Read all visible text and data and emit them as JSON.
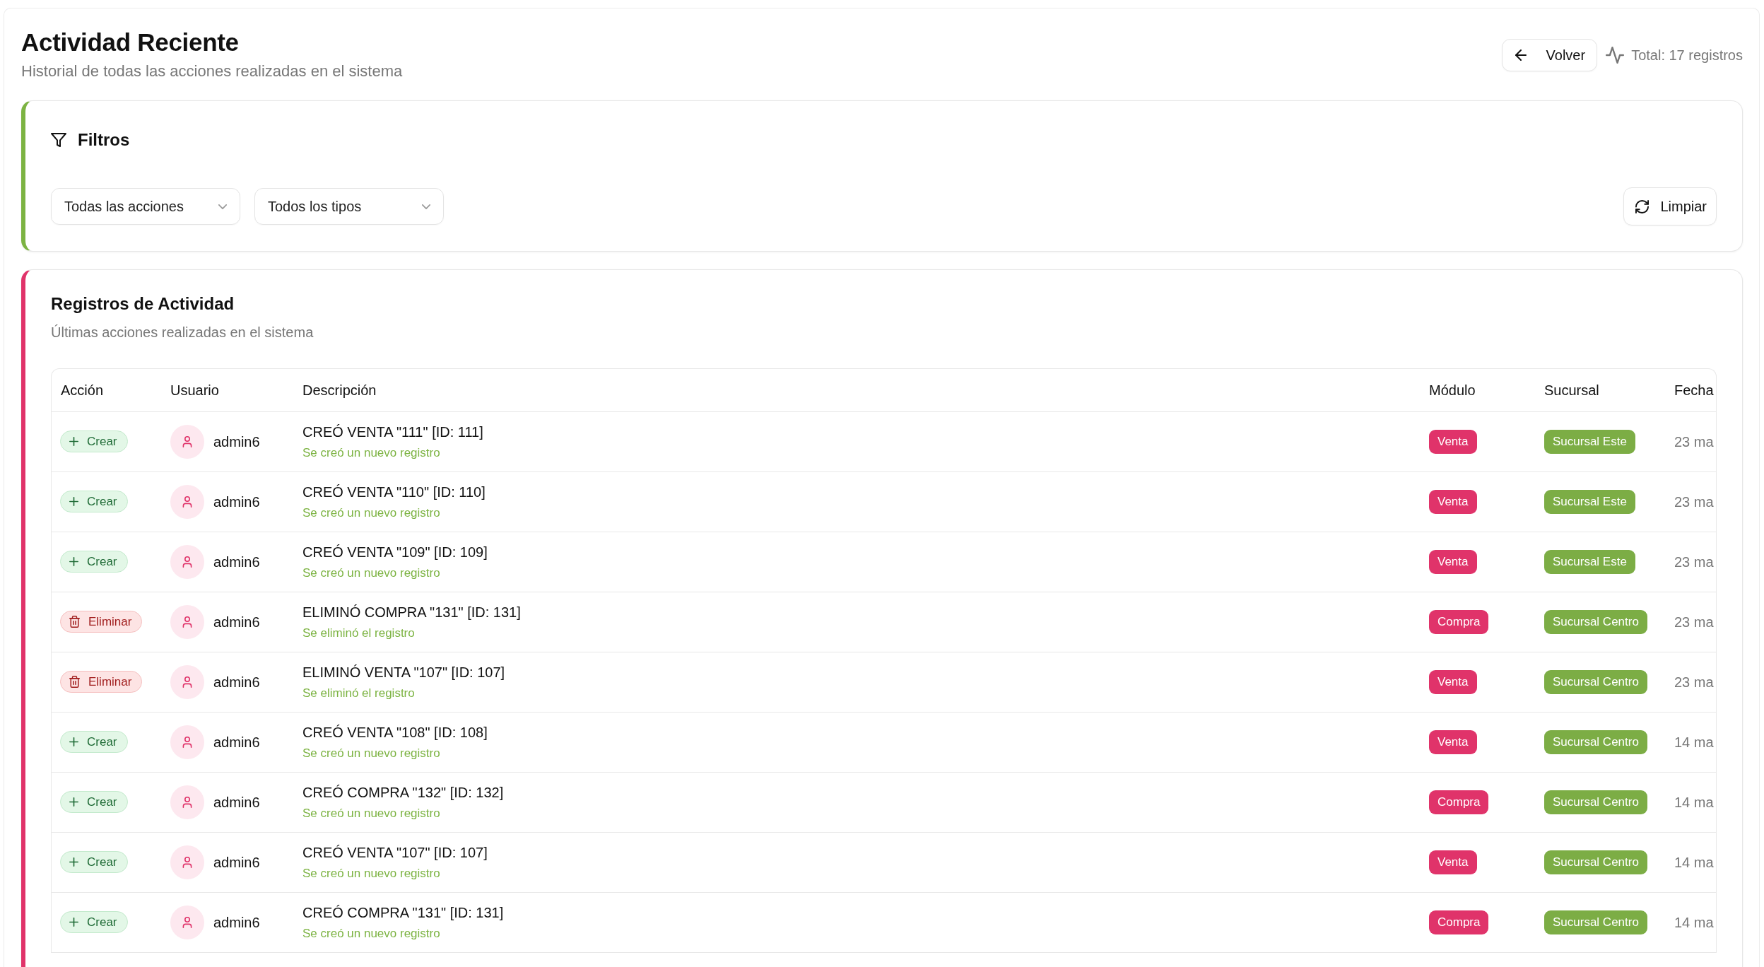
{
  "header": {
    "title": "Actividad Reciente",
    "subtitle": "Historial de todas las acciones realizadas en el sistema",
    "back_button": "Volver",
    "total": "Total: 17 registros"
  },
  "filters": {
    "title": "Filtros",
    "dropdowns": [
      {
        "value": "Todas las acciones"
      },
      {
        "value": "Todos los tipos"
      }
    ],
    "clear_button": "Limpiar"
  },
  "activity": {
    "title": "Registros de Actividad",
    "subtitle": "Últimas acciones realizadas en el sistema",
    "table": {
      "columns": [
        "Acción",
        "Usuario",
        "Descripción",
        "Módulo",
        "Sucursal",
        "Fecha"
      ],
      "rows": [
        {
          "action": {
            "kind": "create",
            "label": "Crear"
          },
          "user": "admin6",
          "description": "CREÓ VENTA \"111\" [ID: 111]",
          "detail": "Se creó un nuevo registro",
          "module": "Venta",
          "branch": "Sucursal Este",
          "date": "23 ma"
        },
        {
          "action": {
            "kind": "create",
            "label": "Crear"
          },
          "user": "admin6",
          "description": "CREÓ VENTA \"110\" [ID: 110]",
          "detail": "Se creó un nuevo registro",
          "module": "Venta",
          "branch": "Sucursal Este",
          "date": "23 ma"
        },
        {
          "action": {
            "kind": "create",
            "label": "Crear"
          },
          "user": "admin6",
          "description": "CREÓ VENTA \"109\" [ID: 109]",
          "detail": "Se creó un nuevo registro",
          "module": "Venta",
          "branch": "Sucursal Este",
          "date": "23 ma"
        },
        {
          "action": {
            "kind": "delete",
            "label": "Eliminar"
          },
          "user": "admin6",
          "description": "ELIMINÓ COMPRA \"131\" [ID: 131]",
          "detail": "Se eliminó el registro",
          "module": "Compra",
          "branch": "Sucursal Centro",
          "date": "23 ma"
        },
        {
          "action": {
            "kind": "delete",
            "label": "Eliminar"
          },
          "user": "admin6",
          "description": "ELIMINÓ VENTA \"107\" [ID: 107]",
          "detail": "Se eliminó el registro",
          "module": "Venta",
          "branch": "Sucursal Centro",
          "date": "23 ma"
        },
        {
          "action": {
            "kind": "create",
            "label": "Crear"
          },
          "user": "admin6",
          "description": "CREÓ VENTA \"108\" [ID: 108]",
          "detail": "Se creó un nuevo registro",
          "module": "Venta",
          "branch": "Sucursal Centro",
          "date": "14 ma"
        },
        {
          "action": {
            "kind": "create",
            "label": "Crear"
          },
          "user": "admin6",
          "description": "CREÓ COMPRA \"132\" [ID: 132]",
          "detail": "Se creó un nuevo registro",
          "module": "Compra",
          "branch": "Sucursal Centro",
          "date": "14 ma"
        },
        {
          "action": {
            "kind": "create",
            "label": "Crear"
          },
          "user": "admin6",
          "description": "CREÓ VENTA \"107\" [ID: 107]",
          "detail": "Se creó un nuevo registro",
          "module": "Venta",
          "branch": "Sucursal Centro",
          "date": "14 ma"
        },
        {
          "action": {
            "kind": "create",
            "label": "Crear"
          },
          "user": "admin6",
          "description": "CREÓ COMPRA \"131\" [ID: 131]",
          "detail": "Se creó un nuevo registro",
          "module": "Compra",
          "branch": "Sucursal Centro",
          "date": "14 ma"
        }
      ]
    }
  }
}
